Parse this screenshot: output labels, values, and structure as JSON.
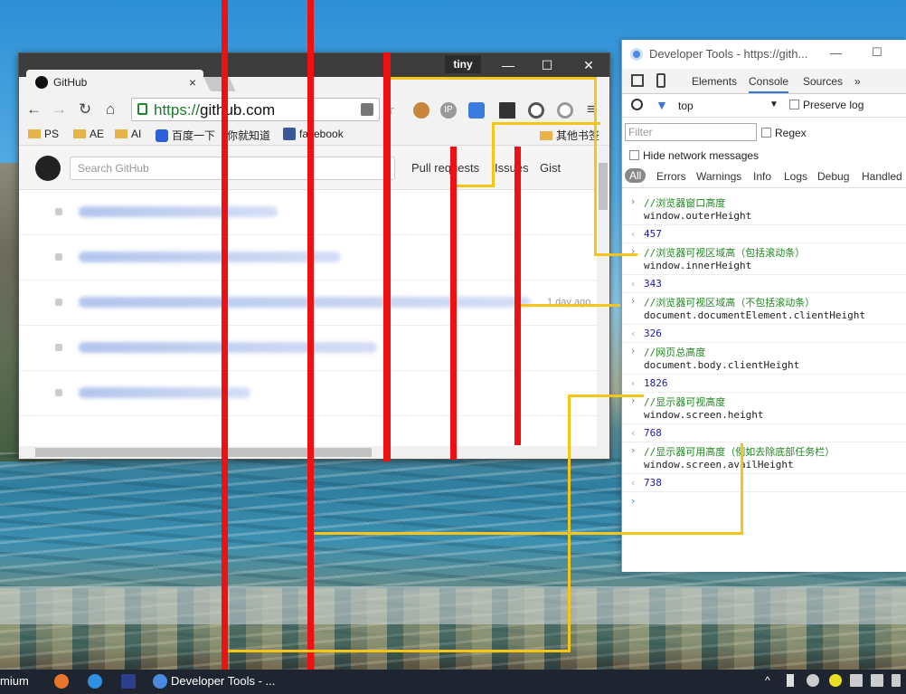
{
  "browser": {
    "badge": "tiny",
    "minimize": "—",
    "maximize": "☐",
    "close": "✕",
    "tab_title": "GitHub",
    "tab_close": "×",
    "url_scheme": "https://",
    "url_host": "github.com",
    "bookmarks": [
      "PS",
      "AE",
      "AI",
      "百度一下",
      "你就知道",
      "facebook",
      "其他书签"
    ],
    "github": {
      "search_placeholder": "Search GitHub",
      "nav": [
        "Pull requests",
        "Issues",
        "Gist"
      ],
      "feed_ago": "1 day ago"
    }
  },
  "devtools": {
    "title": "Developer Tools - https://gith...",
    "minimize": "—",
    "maximize": "☐",
    "tabs": [
      "Elements",
      "Console",
      "Sources",
      "»"
    ],
    "context": "top",
    "preserve_log": "Preserve log",
    "filter_placeholder": "Filter",
    "regex": "Regex",
    "hide_network": "Hide network messages",
    "levels": [
      "All",
      "Errors",
      "Warnings",
      "Info",
      "Logs",
      "Debug",
      "Handled"
    ],
    "entries": [
      {
        "comment": "//浏览器窗口高度",
        "code": "window.outerHeight",
        "result": "457"
      },
      {
        "comment": "//浏览器可视区域高（包括滚动条）",
        "code": "window.innerHeight",
        "result": "343"
      },
      {
        "comment": "//浏览器可视区域高（不包括滚动条）",
        "code": "document.documentElement.clientHeight",
        "result": "326"
      },
      {
        "comment": "//网页总高度",
        "code": "document.body.clientHeight",
        "result": "1826"
      },
      {
        "comment": "//显示器可视高度",
        "code": "window.screen.height",
        "result": "768"
      },
      {
        "comment": "//显示器可用高度（例如去除底部任务栏）",
        "code": "window.screen.availHeight",
        "result": "738"
      }
    ]
  },
  "taskbar": {
    "left_label": "mium",
    "devtools_label": "Developer Tools - ..."
  },
  "colors": {
    "annotation_red": "#ee1111",
    "annotation_yellow": "#f5c518",
    "comment_green": "#1e8a1e",
    "result_blue": "#1a1aa6"
  }
}
